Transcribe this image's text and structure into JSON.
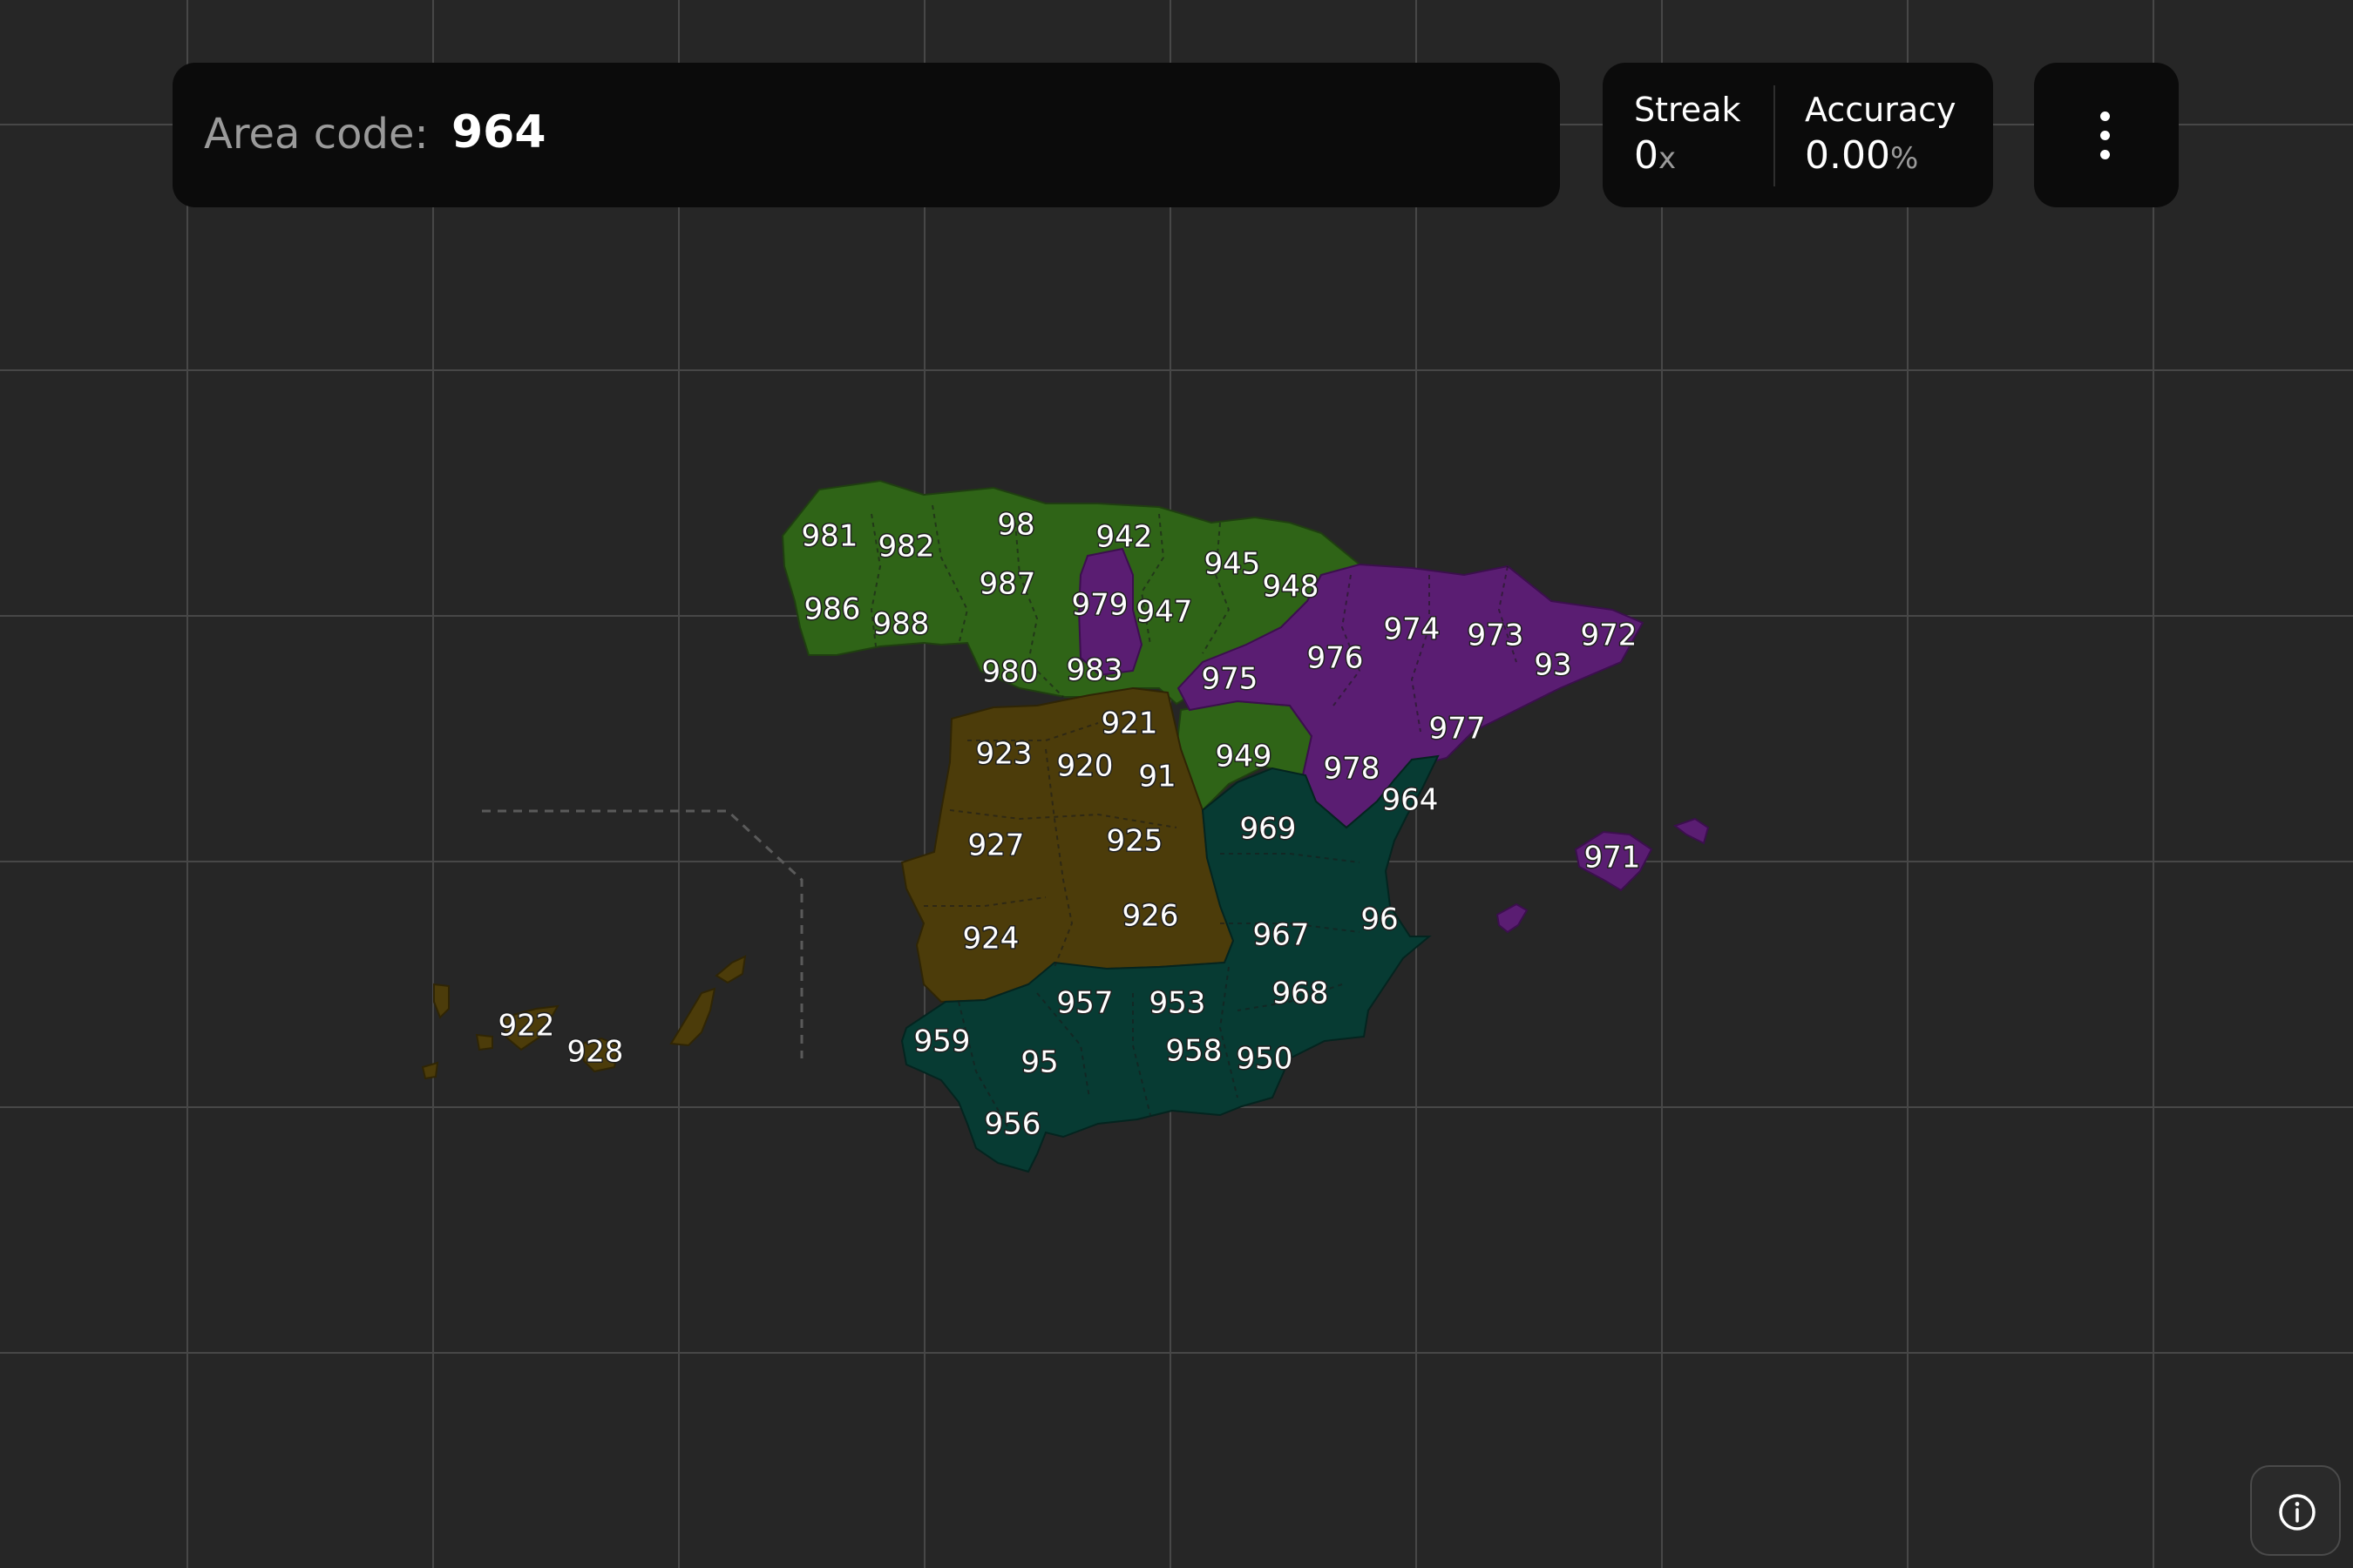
{
  "prompt": {
    "label": "Area code:",
    "value": "964"
  },
  "stats": {
    "streak": {
      "label": "Streak",
      "value": "0",
      "unit": "x"
    },
    "accuracy": {
      "label": "Accuracy",
      "value": "0.00",
      "unit": "%"
    }
  },
  "menu": {
    "icon": "vertical-dots-icon"
  },
  "info": {
    "icon": "info-icon"
  },
  "colors": {
    "background": "#262626",
    "grid": "#474747",
    "panel": "#0b0b0b",
    "green_zone": "#2f6417",
    "purple_zone": "#5a1d72",
    "brown_zone": "#4c3c0a",
    "teal_zone": "#073b33"
  },
  "map": {
    "area_codes": [
      {
        "code": "981",
        "zone": "green"
      },
      {
        "code": "982",
        "zone": "green"
      },
      {
        "code": "98",
        "zone": "green"
      },
      {
        "code": "942",
        "zone": "green"
      },
      {
        "code": "945",
        "zone": "green"
      },
      {
        "code": "948",
        "zone": "green"
      },
      {
        "code": "987",
        "zone": "green"
      },
      {
        "code": "979",
        "zone": "purple"
      },
      {
        "code": "947",
        "zone": "green"
      },
      {
        "code": "986",
        "zone": "green"
      },
      {
        "code": "988",
        "zone": "green"
      },
      {
        "code": "980",
        "zone": "green"
      },
      {
        "code": "983",
        "zone": "green"
      },
      {
        "code": "974",
        "zone": "purple"
      },
      {
        "code": "973",
        "zone": "purple"
      },
      {
        "code": "972",
        "zone": "purple"
      },
      {
        "code": "93",
        "zone": "purple"
      },
      {
        "code": "976",
        "zone": "purple"
      },
      {
        "code": "975",
        "zone": "purple"
      },
      {
        "code": "977",
        "zone": "purple"
      },
      {
        "code": "921",
        "zone": "brown"
      },
      {
        "code": "923",
        "zone": "brown"
      },
      {
        "code": "920",
        "zone": "brown"
      },
      {
        "code": "91",
        "zone": "brown"
      },
      {
        "code": "949",
        "zone": "green"
      },
      {
        "code": "978",
        "zone": "purple"
      },
      {
        "code": "964",
        "zone": "teal"
      },
      {
        "code": "969",
        "zone": "teal"
      },
      {
        "code": "927",
        "zone": "brown"
      },
      {
        "code": "925",
        "zone": "brown"
      },
      {
        "code": "971",
        "zone": "purple"
      },
      {
        "code": "926",
        "zone": "brown"
      },
      {
        "code": "924",
        "zone": "brown"
      },
      {
        "code": "967",
        "zone": "teal"
      },
      {
        "code": "96",
        "zone": "teal"
      },
      {
        "code": "968",
        "zone": "teal"
      },
      {
        "code": "957",
        "zone": "teal"
      },
      {
        "code": "953",
        "zone": "teal"
      },
      {
        "code": "959",
        "zone": "teal"
      },
      {
        "code": "95",
        "zone": "teal"
      },
      {
        "code": "958",
        "zone": "teal"
      },
      {
        "code": "950",
        "zone": "teal"
      },
      {
        "code": "956",
        "zone": "teal"
      },
      {
        "code": "922",
        "zone": "brown"
      },
      {
        "code": "928",
        "zone": "brown"
      }
    ]
  }
}
